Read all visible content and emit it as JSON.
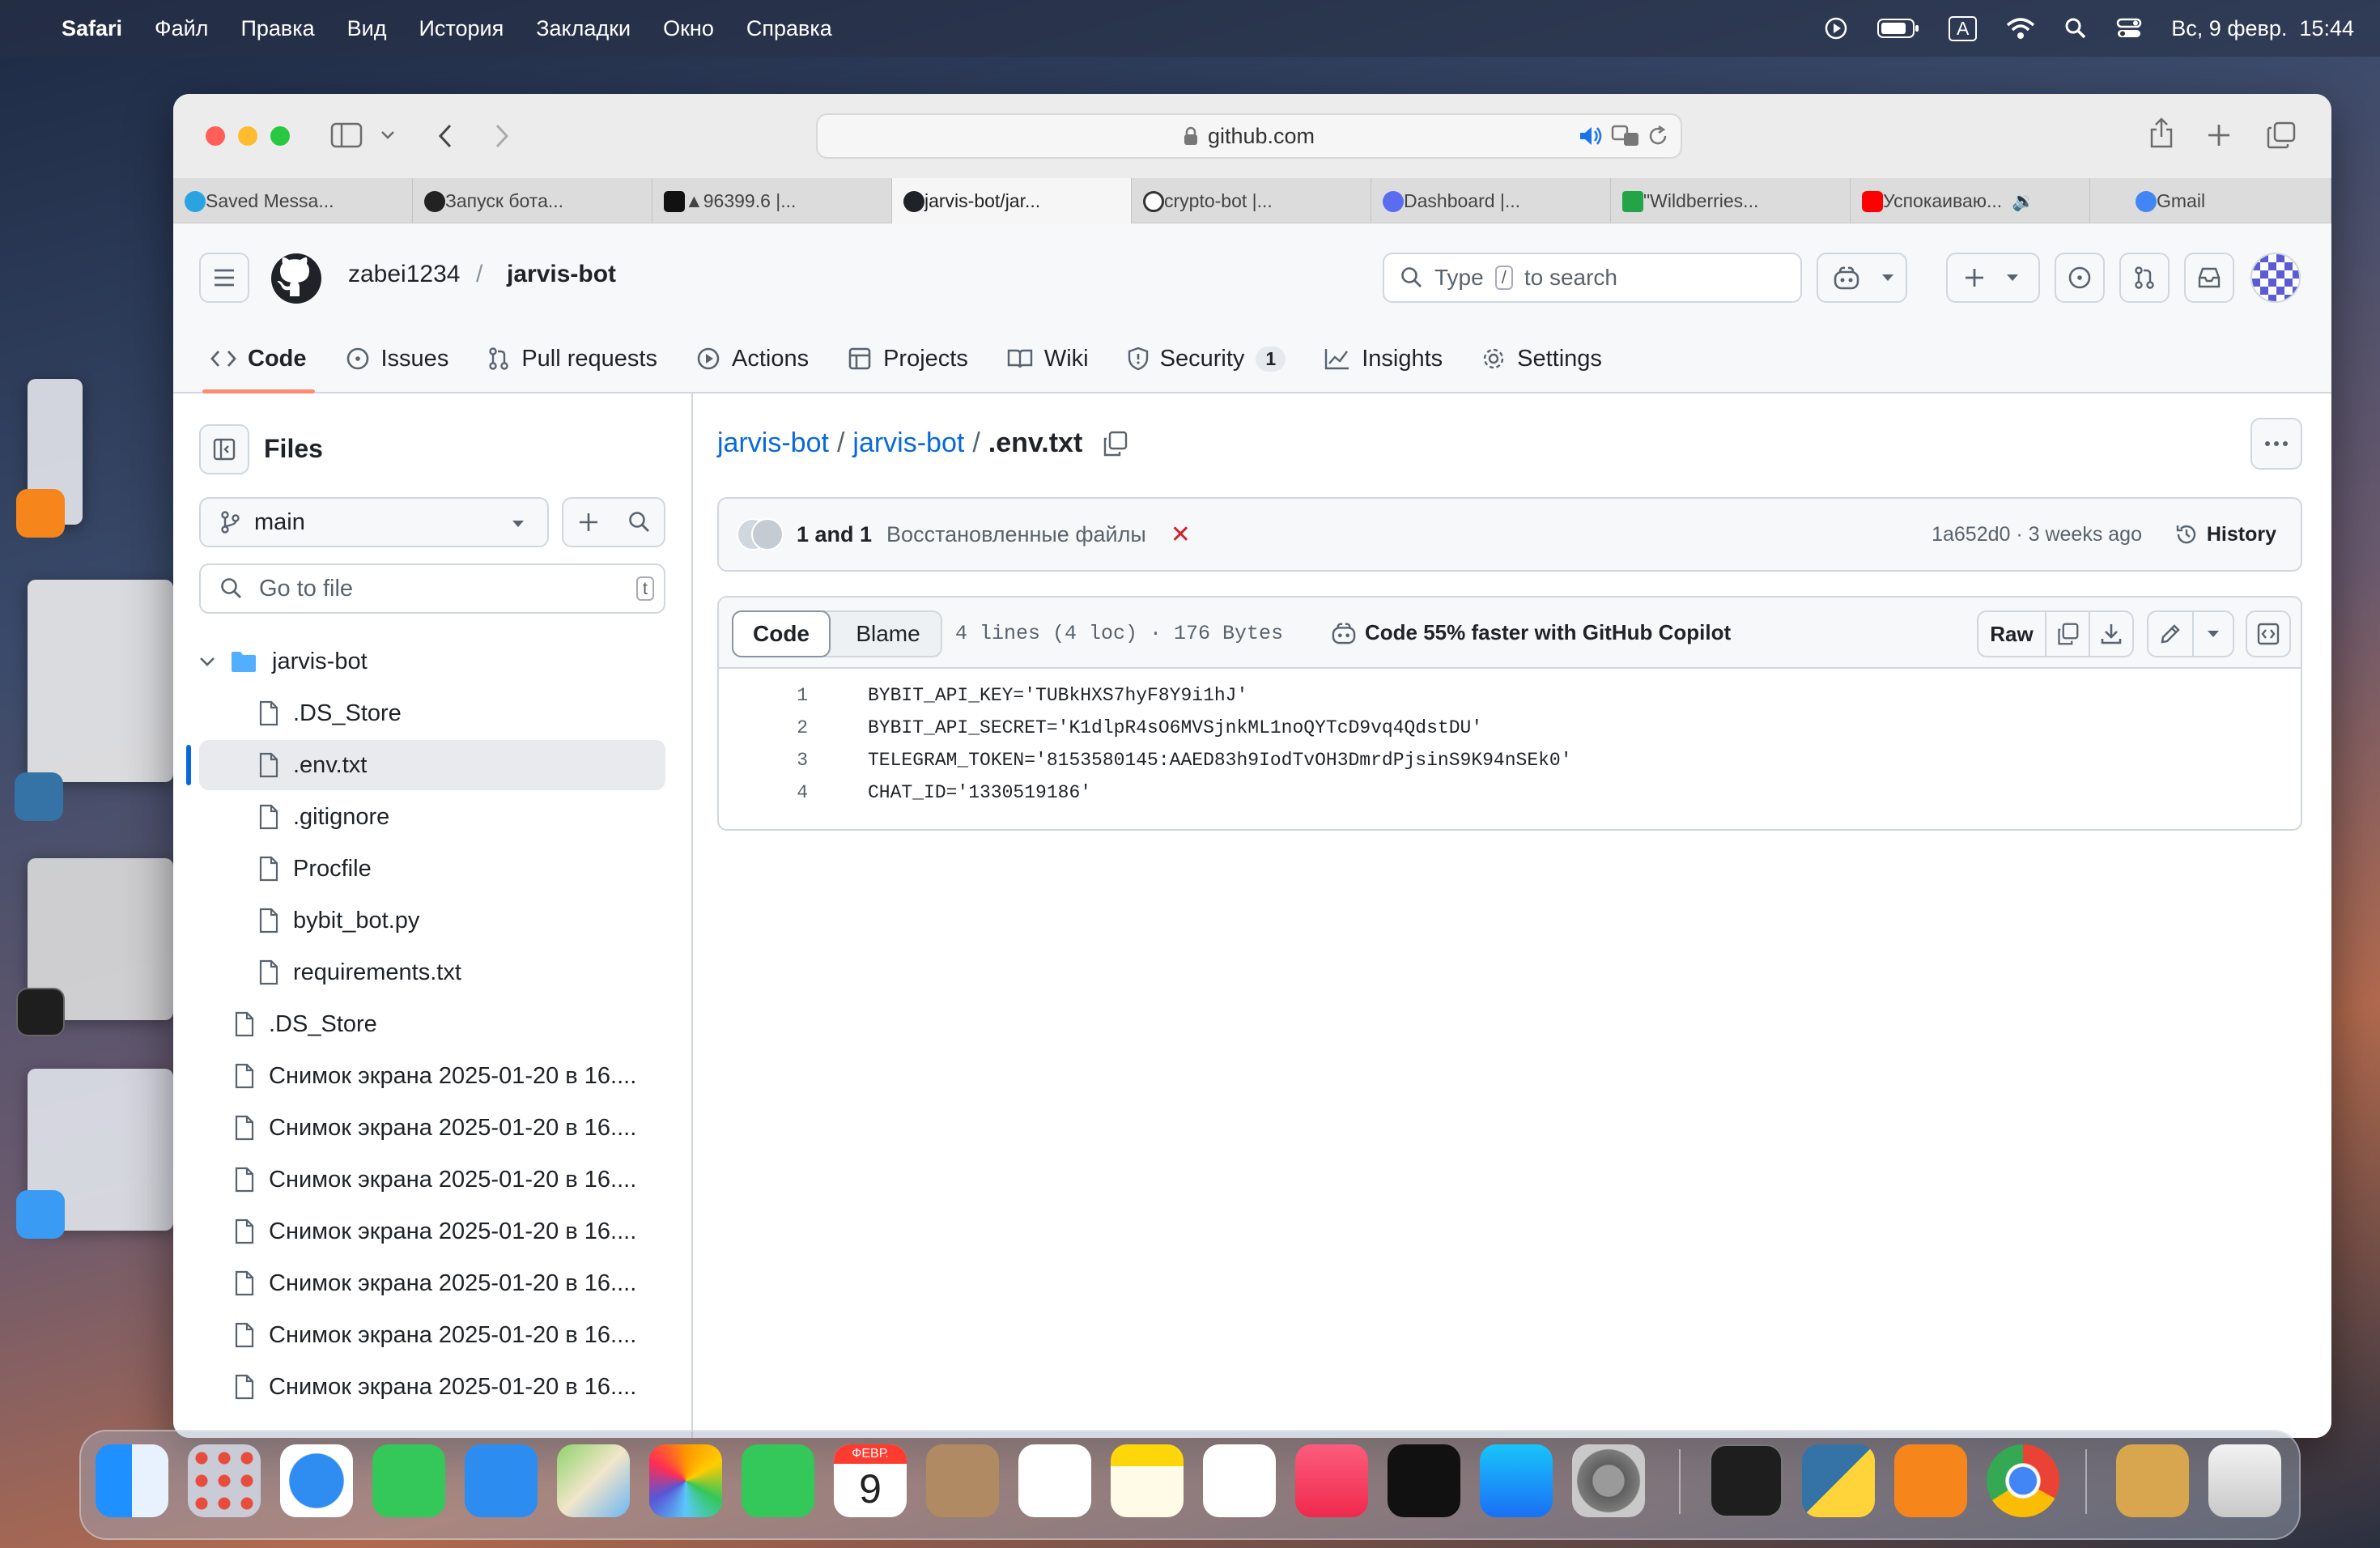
{
  "menubar": {
    "app": "Safari",
    "items": [
      "Файл",
      "Правка",
      "Вид",
      "История",
      "Закладки",
      "Окно",
      "Справка"
    ],
    "input_source": "A",
    "datetime": "Вс, 9 февр.  15:44"
  },
  "browser": {
    "address": "github.com",
    "tabs": [
      {
        "title": "Saved Messa...",
        "color": "#2aa3e3"
      },
      {
        "title": "Запуск бота...",
        "color": "#222222"
      },
      {
        "title": "▲96399.6 |...",
        "color": "#111111"
      },
      {
        "title": "jarvis-bot/jar...",
        "color": "#1f2328"
      },
      {
        "title": "crypto-bot |...",
        "color": "#333333"
      },
      {
        "title": "Dashboard |...",
        "color": "#5a6cf0"
      },
      {
        "title": "\"Wildberries...",
        "color": "#22a447"
      },
      {
        "title": "Успокаиваю...",
        "color": "#ff0000"
      },
      {
        "title": "Gmail",
        "color": "#4285f4"
      }
    ]
  },
  "github": {
    "owner": "zabei1234",
    "repo": "jarvis-bot",
    "search_placeholder_pre": "Type",
    "search_key": "/",
    "search_placeholder_post": "to search",
    "nav": [
      {
        "label": "Code",
        "icon": "code-icon"
      },
      {
        "label": "Issues",
        "icon": "issues-icon"
      },
      {
        "label": "Pull requests",
        "icon": "pull-request-icon"
      },
      {
        "label": "Actions",
        "icon": "actions-icon"
      },
      {
        "label": "Projects",
        "icon": "projects-icon"
      },
      {
        "label": "Wiki",
        "icon": "wiki-icon"
      },
      {
        "label": "Security",
        "icon": "shield-icon",
        "count": "1"
      },
      {
        "label": "Insights",
        "icon": "graph-icon"
      },
      {
        "label": "Settings",
        "icon": "gear-icon"
      }
    ]
  },
  "sidebar": {
    "title": "Files",
    "branch": "main",
    "goto_placeholder": "Go to file",
    "goto_key": "t",
    "folder": "jarvis-bot",
    "children": [
      ".DS_Store",
      ".env.txt",
      ".gitignore",
      "Procfile",
      "bybit_bot.py",
      "requirements.txt"
    ],
    "root_files": [
      ".DS_Store",
      "Снимок экрана 2025-01-20 в 16....",
      "Снимок экрана 2025-01-20 в 16....",
      "Снимок экрана 2025-01-20 в 16....",
      "Снимок экрана 2025-01-20 в 16....",
      "Снимок экрана 2025-01-20 в 16....",
      "Снимок экрана 2025-01-20 в 16....",
      "Снимок экрана 2025-01-20 в 16...."
    ]
  },
  "file": {
    "crumb_repo": "jarvis-bot",
    "crumb_folder": "jarvis-bot",
    "crumb_file": ".env.txt",
    "commit_authors": "1 and 1",
    "commit_message": "Восстановленные файлы",
    "commit_status": "✕",
    "commit_meta": "1a652d0 · 3 weeks ago",
    "history_label": "History",
    "view_code": "Code",
    "view_blame": "Blame",
    "stats": "4 lines (4 loc) · 176 Bytes",
    "copilot": "Code 55% faster with GitHub Copilot",
    "raw_label": "Raw",
    "lines": [
      {
        "n": "1",
        "text": "BYBIT_API_KEY='TUBkHXS7hyF8Y9i1hJ'"
      },
      {
        "n": "2",
        "text": "BYBIT_API_SECRET='K1dlpR4sO6MVSjnkML1noQYTcD9vq4QdstDU'"
      },
      {
        "n": "3",
        "text": "TELEGRAM_TOKEN='8153580145:AAED83h9IodTvOH3DmrdPjsinS9K94nSEk0'"
      },
      {
        "n": "4",
        "text": "CHAT_ID='1330519186'"
      }
    ]
  },
  "dock": {
    "calendar_month": "ФЕВР.",
    "calendar_day": "9",
    "apps": [
      "finder-icon",
      "launchpad-icon",
      "safari-icon",
      "messages-icon",
      "mail-icon",
      "maps-icon",
      "photos-icon",
      "facetime-icon",
      "calendar-icon",
      "contacts-icon",
      "reminders-icon",
      "notes-icon",
      "freeform-icon",
      "music-icon",
      "tv-icon",
      "app-store-icon",
      "system-settings-icon",
      "terminal-icon",
      "python-launcher-icon",
      "metamask-icon",
      "chrome-icon",
      "archive-utility-icon",
      "trash-icon"
    ]
  },
  "colors": {
    "accent": "#0969da",
    "tab_underline": "#fd8c73",
    "danger": "#cf222e"
  }
}
